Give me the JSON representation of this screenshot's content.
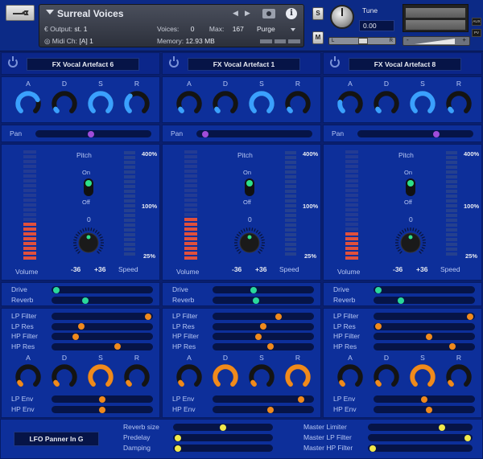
{
  "header": {
    "instrument_name": "Surreal Voices",
    "output_label": "Output:",
    "output_value": "st. 1",
    "midi_label": "Midi Ch:",
    "midi_value": "[A] 1",
    "voices_label": "Voices:",
    "voices_value": "0",
    "max_label": "Max:",
    "max_value": "167",
    "memory_label": "Memory:",
    "memory_value": "12.93 MB",
    "purge_label": "Purge",
    "nav_prev": "◀",
    "nav_next": "▶",
    "info": "i",
    "solo": "S",
    "mute": "M",
    "tune_label": "Tune",
    "tune_value": "0.00",
    "pan_left": "L",
    "pan_right": "R",
    "aux": "AUX",
    "pv": "PV",
    "vol_minus": "-",
    "vol_plus": "+"
  },
  "columns": [
    {
      "preset": "FX Vocal Artefact 6",
      "adsr_labels": [
        "A",
        "D",
        "S",
        "R"
      ],
      "adsr_levels": [
        0.75,
        0.05,
        1.0,
        0.35
      ],
      "pan_label": "Pan",
      "pan_value": 0.48,
      "volume_label": "Volume",
      "volume_level": 0.34,
      "pitch_label": "Pitch",
      "on_label": "On",
      "off_label": "Off",
      "pitch_zero": "0",
      "pitch_min": "-36",
      "pitch_max": "+36",
      "pitch_level": 0.5,
      "speed_label": "Speed",
      "speed_top": "400%",
      "speed_mid": "100%",
      "speed_low": "25%",
      "drive_label": "Drive",
      "drive_value": 0.02,
      "reverb_label": "Reverb",
      "reverb_value": 0.32,
      "filters": [
        {
          "label": "LP Filter",
          "value": 0.98
        },
        {
          "label": "LP Res",
          "value": 0.28
        },
        {
          "label": "HP Filter",
          "value": 0.22
        },
        {
          "label": "HP Res",
          "value": 0.66
        }
      ],
      "filter_adsr_labels": [
        "A",
        "D",
        "S",
        "R"
      ],
      "filter_adsr_levels": [
        0.05,
        0.05,
        1.0,
        0.05
      ],
      "env": [
        {
          "label": "LP Env",
          "value": 0.5
        },
        {
          "label": "HP Env",
          "value": 0.5
        }
      ]
    },
    {
      "preset": "FX Vocal Artefact 1",
      "adsr_labels": [
        "A",
        "D",
        "S",
        "R"
      ],
      "adsr_levels": [
        0.05,
        0.05,
        1.0,
        0.05
      ],
      "pan_label": "Pan",
      "pan_value": 0.05,
      "volume_label": "Volume",
      "volume_level": 0.41,
      "pitch_label": "Pitch",
      "on_label": "On",
      "off_label": "Off",
      "pitch_zero": "0",
      "pitch_min": "-36",
      "pitch_max": "+36",
      "pitch_level": 0.5,
      "speed_label": "Speed",
      "speed_top": "400%",
      "speed_mid": "100%",
      "speed_low": "25%",
      "drive_label": "Drive",
      "drive_value": 0.4,
      "reverb_label": "Reverb",
      "reverb_value": 0.42,
      "filters": [
        {
          "label": "LP Filter",
          "value": 0.66
        },
        {
          "label": "LP Res",
          "value": 0.5
        },
        {
          "label": "HP Filter",
          "value": 0.45
        },
        {
          "label": "HP Res",
          "value": 0.58
        }
      ],
      "filter_adsr_labels": [
        "A",
        "D",
        "S",
        "R"
      ],
      "filter_adsr_levels": [
        0.05,
        1.0,
        0.05,
        1.0
      ],
      "env": [
        {
          "label": "LP Env",
          "value": 0.9
        },
        {
          "label": "HP Env",
          "value": 0.58
        }
      ]
    },
    {
      "preset": "FX Vocal Artefact 8",
      "adsr_labels": [
        "A",
        "D",
        "S",
        "R"
      ],
      "adsr_levels": [
        0.2,
        0.05,
        1.0,
        0.05
      ],
      "pan_label": "Pan",
      "pan_value": 0.69,
      "volume_label": "Volume",
      "volume_level": 0.25,
      "pitch_label": "Pitch",
      "on_label": "On",
      "off_label": "Off",
      "pitch_zero": "0",
      "pitch_min": "-36",
      "pitch_max": "+36",
      "pitch_level": 0.5,
      "speed_label": "Speed",
      "speed_top": "400%",
      "speed_mid": "100%",
      "speed_low": "25%",
      "drive_label": "Drive",
      "drive_value": 0.02,
      "reverb_label": "Reverb",
      "reverb_value": 0.25,
      "filters": [
        {
          "label": "LP Filter",
          "value": 0.98
        },
        {
          "label": "LP Res",
          "value": 0.02
        },
        {
          "label": "HP Filter",
          "value": 0.55
        },
        {
          "label": "HP Res",
          "value": 0.8
        }
      ],
      "filter_adsr_labels": [
        "A",
        "D",
        "S",
        "R"
      ],
      "filter_adsr_levels": [
        0.05,
        0.05,
        1.0,
        0.05
      ],
      "env": [
        {
          "label": "LP Env",
          "value": 0.5
        },
        {
          "label": "HP Env",
          "value": 0.55
        }
      ]
    }
  ],
  "footer": {
    "lfo_button": "LFO Panner In G",
    "left_params": [
      {
        "label": "Reverb size",
        "value": 0.5
      },
      {
        "label": "Predelay",
        "value": 0.02
      },
      {
        "label": "Damping",
        "value": 0.02
      }
    ],
    "right_params": [
      {
        "label": "Master Limiter",
        "value": 0.72
      },
      {
        "label": "Master LP Filter",
        "value": 0.98
      },
      {
        "label": "Master HP Filter",
        "value": 0.02
      }
    ]
  },
  "colors": {
    "knob_blue": "#3aa0ff",
    "knob_orange": "#f08a1c",
    "pan_dot": "#a04cd9",
    "fx_dot": "#2ad89a",
    "filter_dot": "#f08a1c",
    "footer_dot": "#f0e84a",
    "volume_led": "#e0503c"
  }
}
